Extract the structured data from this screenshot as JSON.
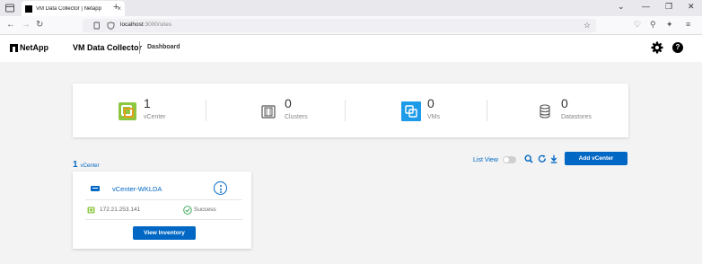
{
  "browser": {
    "tab_title": "VM Data Collector | Netapp",
    "tab_close": "×",
    "new_tab": "+",
    "url_host": "localhost",
    "url_path": ":3000/sites"
  },
  "header": {
    "logo": "NetApp",
    "app_title": "VM Data Collector",
    "breadcrumb": "Dashboard",
    "help": "?"
  },
  "summary": {
    "stats": [
      {
        "count": "1",
        "label": "vCenter"
      },
      {
        "count": "0",
        "label": "Clusters"
      },
      {
        "count": "0",
        "label": "VMs"
      },
      {
        "count": "0",
        "label": "Datastores"
      }
    ]
  },
  "toolbar": {
    "count": "1",
    "count_label": "vCenter",
    "list_view_label": "List View",
    "add_label": "Add vCenter"
  },
  "vcenter_card": {
    "name": "vCenter-WKLDA",
    "ip": "172.21.253.141",
    "status": "Success",
    "view_inventory_label": "View Inventory"
  },
  "colors": {
    "accent": "#0067c5",
    "vcenter_icon": "#8dc63f",
    "vm_icon": "#1e9be8",
    "success": "#2ea44f"
  }
}
